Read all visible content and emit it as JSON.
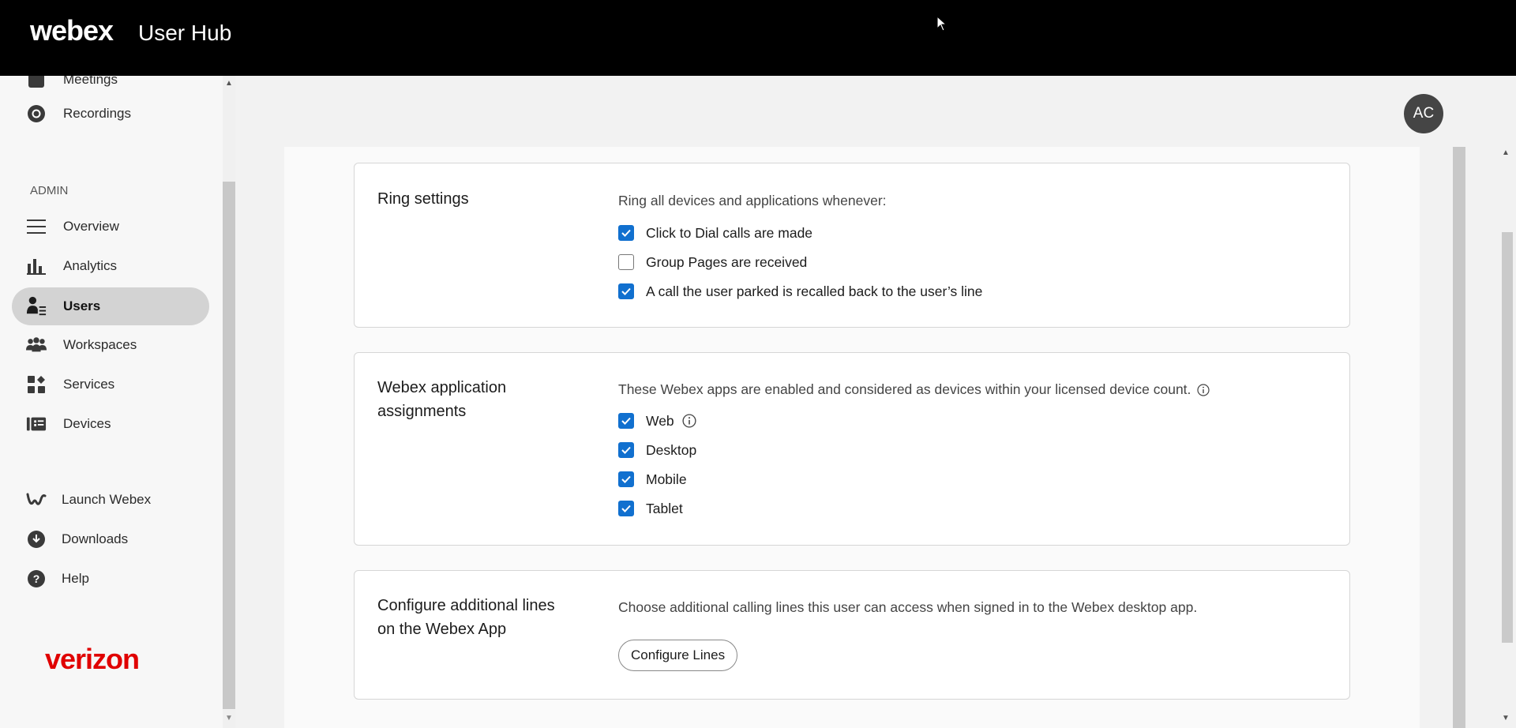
{
  "header": {
    "brand": "webex",
    "product": "User Hub"
  },
  "sidebar": {
    "top_items": [
      {
        "label": "Meetings",
        "icon": "calendar-icon"
      },
      {
        "label": "Recordings",
        "icon": "recording-icon"
      }
    ],
    "admin_label": "ADMIN",
    "admin_items": [
      {
        "label": "Overview",
        "icon": "list-icon"
      },
      {
        "label": "Analytics",
        "icon": "bar-chart-icon"
      },
      {
        "label": "Users",
        "icon": "users-list-icon",
        "active": true
      },
      {
        "label": "Workspaces",
        "icon": "people-group-icon"
      },
      {
        "label": "Services",
        "icon": "apps-grid-icon"
      },
      {
        "label": "Devices",
        "icon": "devices-icon"
      }
    ],
    "bottom_items": [
      {
        "label": "Launch Webex",
        "icon": "webex-logo-icon"
      },
      {
        "label": "Downloads",
        "icon": "download-icon"
      },
      {
        "label": "Help",
        "icon": "help-icon"
      }
    ],
    "partner_logo": "verizon"
  },
  "user": {
    "initials": "AC"
  },
  "ring_settings": {
    "title": "Ring settings",
    "description": "Ring all devices and applications whenever:",
    "options": [
      {
        "label": "Click to Dial calls are made",
        "checked": true
      },
      {
        "label": "Group Pages are received",
        "checked": false
      },
      {
        "label": "A call the user parked is recalled back to the user’s line",
        "checked": true
      }
    ]
  },
  "app_assignments": {
    "title": "Webex application assignments",
    "description": "These Webex apps are enabled and considered as devices within your licensed device count.",
    "options": [
      {
        "label": "Web",
        "checked": true
      },
      {
        "label": "Desktop",
        "checked": true
      },
      {
        "label": "Mobile",
        "checked": true
      },
      {
        "label": "Tablet",
        "checked": true
      }
    ]
  },
  "additional_lines": {
    "title": "Configure additional lines on the Webex App",
    "description": "Choose additional calling lines this user can access when signed in to the Webex desktop app.",
    "button_label": "Configure Lines"
  },
  "colors": {
    "accent": "#1170cf",
    "topbar": "#000000",
    "active_nav": "#d3d3d3",
    "brand_red": "#e00000"
  }
}
